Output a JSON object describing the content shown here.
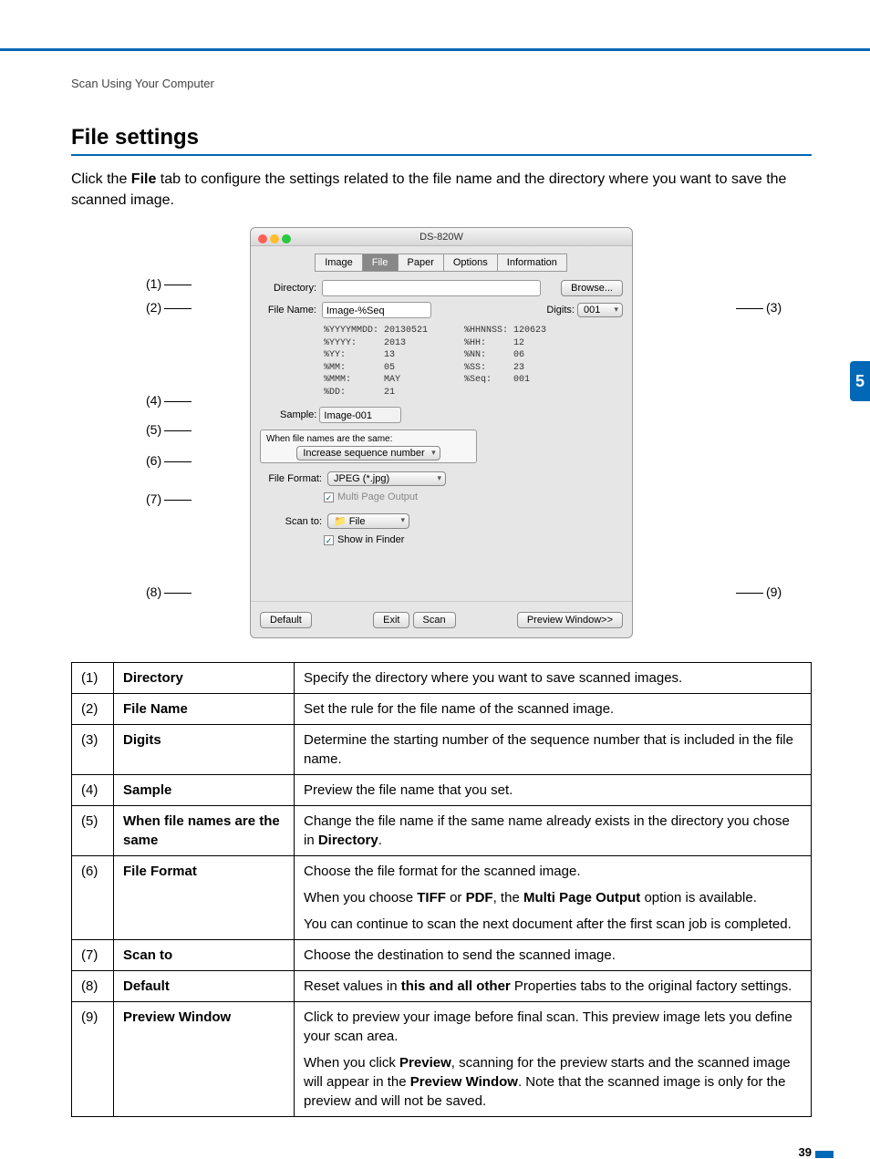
{
  "breadcrumb": "Scan Using Your Computer",
  "heading": "File settings",
  "intro_pre": "Click the ",
  "intro_bold": "File",
  "intro_post": " tab to configure the settings related to the file name and the directory where you want to save the scanned image.",
  "chapter_tab": "5",
  "page_number": "39",
  "callouts_left": {
    "c1": "(1)",
    "c2": "(2)",
    "c4": "(4)",
    "c5": "(5)",
    "c6": "(6)",
    "c7": "(7)",
    "c8": "(8)"
  },
  "callouts_right": {
    "c3": "(3)",
    "c9": "(9)"
  },
  "win": {
    "title": "DS-820W",
    "tabs": {
      "image": "Image",
      "file": "File",
      "paper": "Paper",
      "options": "Options",
      "info": "Information"
    },
    "labels": {
      "directory": "Directory:",
      "file_name": "File Name:",
      "digits": "Digits:",
      "sample": "Sample:",
      "same_header": "When file names are the same:",
      "file_format": "File Format:",
      "scan_to": "Scan to:"
    },
    "vals": {
      "file_name": "Image-%Seq",
      "digits": "001",
      "sample": "Image-001",
      "same_sel": "Increase sequence number",
      "file_format": "JPEG (*.jpg)",
      "scan_to": "📁 File"
    },
    "btns": {
      "browse": "Browse...",
      "default": "Default",
      "exit": "Exit",
      "scan": "Scan",
      "preview": "Preview Window>>"
    },
    "chk": {
      "multi": "Multi Page Output",
      "finder": "Show in Finder"
    },
    "codes_l": "%YYYYMMDD: 20130521\n%YYYY:     2013\n%YY:       13\n%MM:       05\n%MMM:      MAY\n%DD:       21",
    "codes_r": "%HHNNSS: 120623\n%HH:     12\n%NN:     06\n%SS:     23\n%Seq:    001"
  },
  "tbl": {
    "r1": {
      "n": "(1)",
      "k": "Directory",
      "d": "Specify the directory where you want to save scanned images."
    },
    "r2": {
      "n": "(2)",
      "k": "File Name",
      "d": "Set the rule for the file name of the scanned image."
    },
    "r3": {
      "n": "(3)",
      "k": "Digits",
      "d": "Determine the starting number of the sequence number that is included in the file name."
    },
    "r4": {
      "n": "(4)",
      "k": "Sample",
      "d": "Preview the file name that you set."
    },
    "r5": {
      "n": "(5)",
      "k": "When file names are the same",
      "d_pre": "Change the file name if the same name already exists in the directory you chose in ",
      "d_bold": "Directory",
      "d_post": "."
    },
    "r6": {
      "n": "(6)",
      "k": "File Format",
      "d1": "Choose the file format for the scanned image.",
      "d2_pre": "When you choose ",
      "d2_b1": "TIFF",
      "d2_mid": " or ",
      "d2_b2": "PDF",
      "d2_mid2": ", the ",
      "d2_b3": "Multi Page Output",
      "d2_post": " option is available.",
      "d3": "You can continue to scan the next document after the first scan job is completed."
    },
    "r7": {
      "n": "(7)",
      "k": "Scan to",
      "d": "Choose the destination to send the scanned image."
    },
    "r8": {
      "n": "(8)",
      "k": "Default",
      "d_pre": "Reset values in ",
      "d_bold": "this and all other",
      "d_post": " Properties tabs to the original factory settings."
    },
    "r9": {
      "n": "(9)",
      "k": "Preview Window",
      "d1": "Click to preview your image before final scan. This preview image lets you define your scan area.",
      "d2_pre": "When you click ",
      "d2_b1": "Preview",
      "d2_mid": ", scanning for the preview starts and the scanned image will appear in the ",
      "d2_b2": "Preview Window",
      "d2_post": ". Note that the scanned image is only for the preview and will not be saved."
    }
  }
}
